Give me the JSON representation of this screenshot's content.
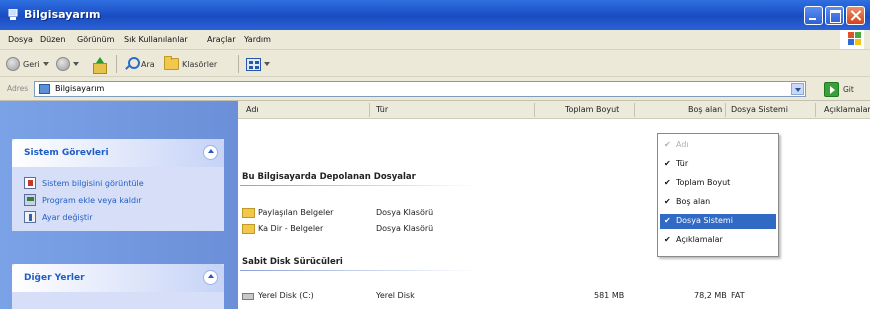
{
  "window": {
    "title": "Bilgisayarım",
    "minimize": "minimize",
    "maximize": "maximize",
    "close": "close"
  },
  "menu": [
    "Dosya",
    "Düzen",
    "Görünüm",
    "Sık Kullanılanlar",
    "Araçlar",
    "Yardım"
  ],
  "toolbar": {
    "back_label": "Geri",
    "search_label": "Ara",
    "folders_label": "Klasörler"
  },
  "address": {
    "label": "Adres",
    "value": "Bilgisayarım",
    "go_label": "Git"
  },
  "left_panel": {
    "system_tasks": {
      "title": "Sistem Görevleri",
      "items": [
        "Sistem bilgisini görüntüle",
        "Program ekle veya kaldır",
        "Ayar değiştir"
      ]
    },
    "other_places": {
      "title": "Diğer Yerler"
    }
  },
  "columns": [
    "Adı",
    "Tür",
    "Toplam Boyut",
    "Boş alan",
    "Dosya Sistemi",
    "Açıklamalar"
  ],
  "groups": [
    {
      "title": "Bu Bilgisayarda Depolanan Dosyalar",
      "rows": [
        {
          "name": "Paylaşılan Belgeler",
          "type": "Dosya Klasörü",
          "icon": "folder-icon"
        },
        {
          "name": "Ka Dir - Belgeler",
          "type": "Dosya Klasörü",
          "icon": "folder-icon"
        }
      ]
    },
    {
      "title": "Sabit Disk Sürücüleri",
      "rows": [
        {
          "name": "Yerel Disk (C:)",
          "type": "Yerel Disk",
          "total": "581 MB",
          "free": "78,2 MB",
          "fs": "FAT",
          "icon": "disk-icon"
        }
      ]
    }
  ],
  "context_menu": {
    "items": [
      {
        "label": "Adı",
        "checked": true,
        "disabled": true,
        "selected": false
      },
      {
        "label": "Tür",
        "checked": true,
        "disabled": false,
        "selected": false
      },
      {
        "label": "Toplam Boyut",
        "checked": true,
        "disabled": false,
        "selected": false
      },
      {
        "label": "Boş alan",
        "checked": true,
        "disabled": false,
        "selected": false
      },
      {
        "label": "Dosya Sistemi",
        "checked": true,
        "disabled": false,
        "selected": true
      },
      {
        "label": "Açıklamalar",
        "checked": true,
        "disabled": false,
        "selected": false
      }
    ],
    "check_mark": "✔"
  },
  "colors": {
    "titlebar": "#1c52c9",
    "left_panel": "#7ba2e7",
    "link": "#215dc6",
    "selection": "#316ac5"
  }
}
